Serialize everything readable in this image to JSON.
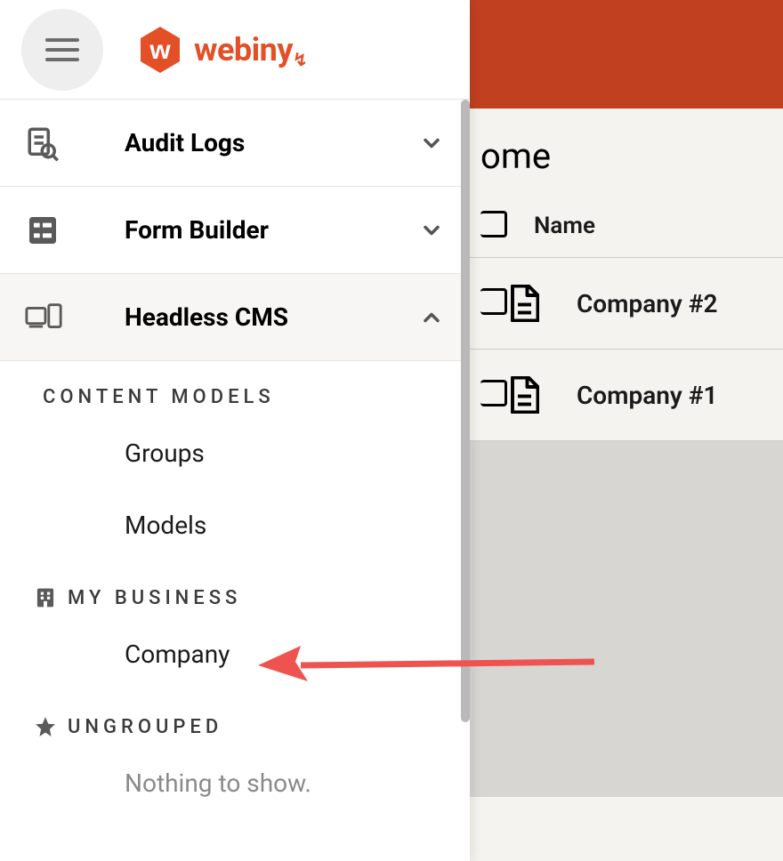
{
  "brand": {
    "name": "webiny"
  },
  "sidebar": {
    "nav": [
      {
        "label": "Audit Logs",
        "expanded": false
      },
      {
        "label": "Form Builder",
        "expanded": false
      },
      {
        "label": "Headless CMS",
        "expanded": true
      }
    ],
    "sections": {
      "content_models": {
        "label": "CONTENT MODELS",
        "items": [
          "Groups",
          "Models"
        ]
      },
      "my_business": {
        "label": "MY BUSINESS",
        "items": [
          "Company"
        ]
      },
      "ungrouped": {
        "label": "UNGROUPED",
        "empty_text": "Nothing to show."
      }
    }
  },
  "content": {
    "heading_partial": "ome",
    "columns": {
      "name": "Name"
    },
    "rows": [
      {
        "name": "Company #2"
      },
      {
        "name": "Company #1"
      }
    ]
  }
}
